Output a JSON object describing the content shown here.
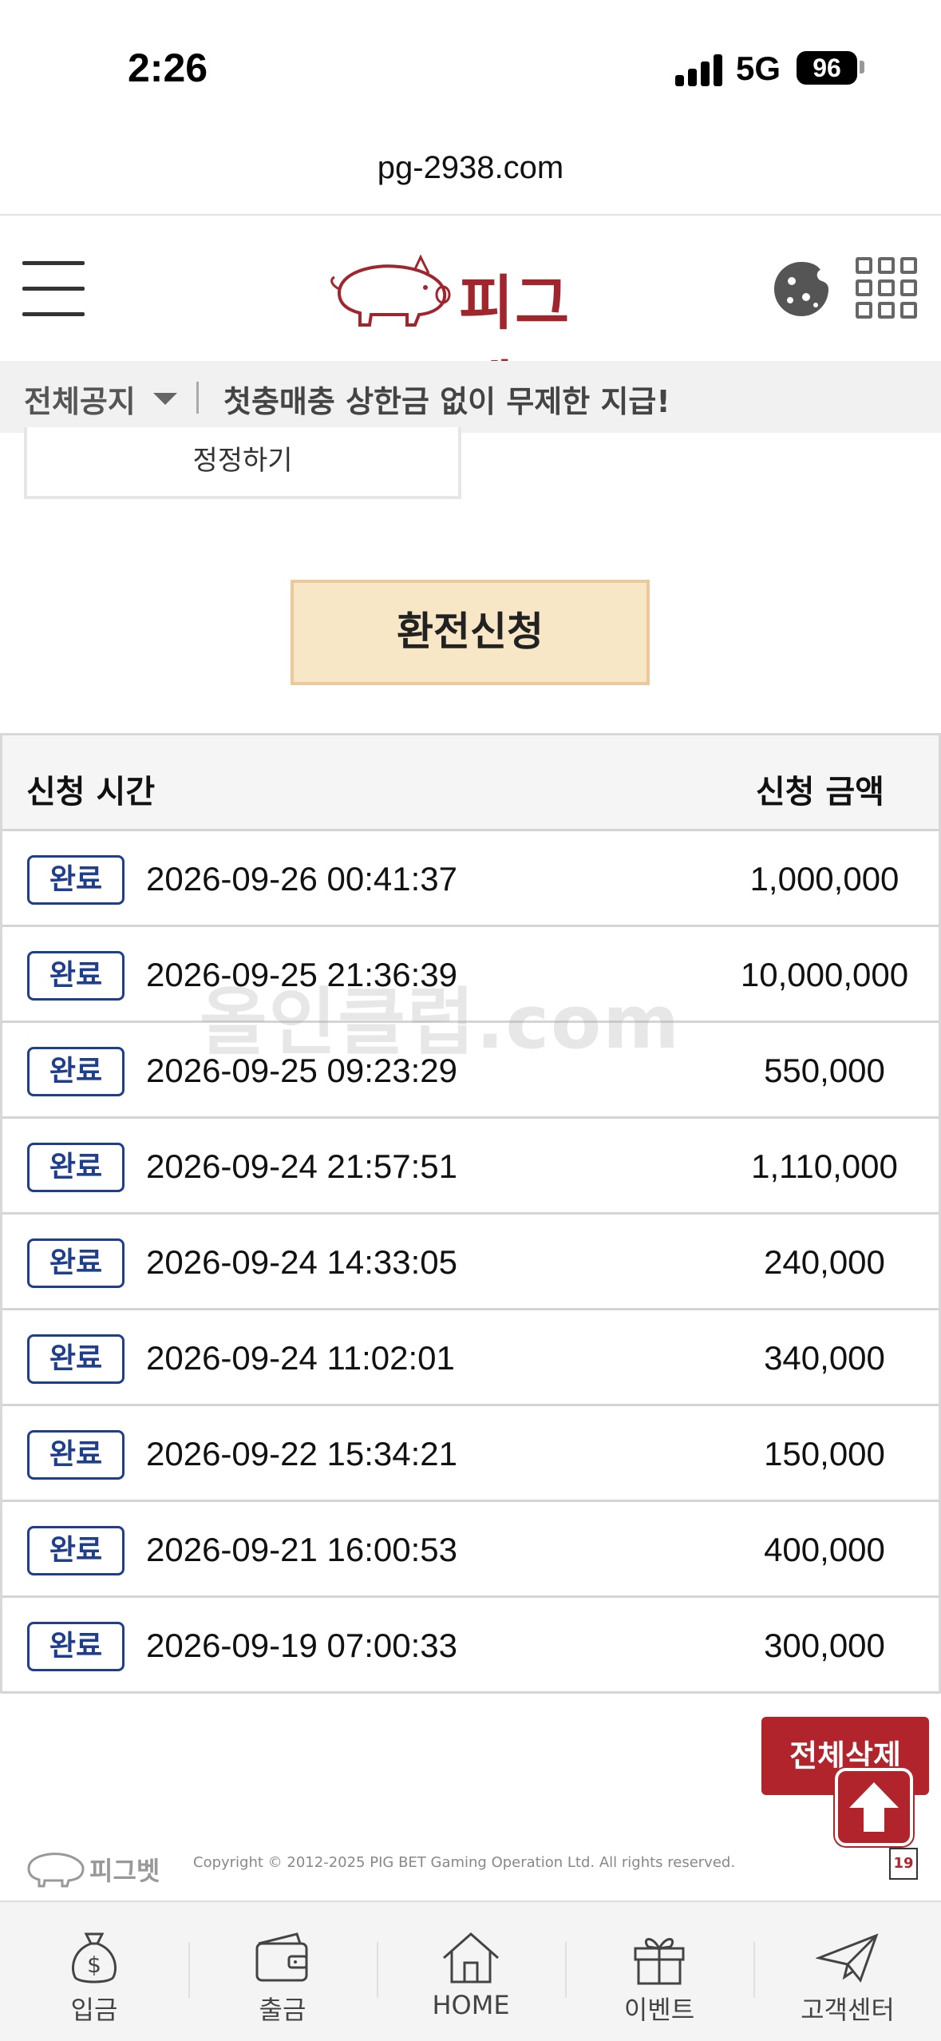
{
  "status": {
    "time": "2:26",
    "network": "5G",
    "battery": "96"
  },
  "browser": {
    "url": "pg-2938.com"
  },
  "header": {
    "logo_text": "피그벳"
  },
  "notice": {
    "label": "전체공지",
    "text": "첫충매충 상한금 없이 무제한 지급!"
  },
  "buttons": {
    "correct": "정정하기",
    "exchange": "환전신청",
    "delete_all": "전체삭제"
  },
  "table": {
    "col_time": "신청 시간",
    "col_amount": "신청 금액",
    "rows": [
      {
        "status": "완료",
        "time": "2026-09-26 00:41:37",
        "amount": "1,000,000"
      },
      {
        "status": "완료",
        "time": "2026-09-25 21:36:39",
        "amount": "10,000,000"
      },
      {
        "status": "완료",
        "time": "2026-09-25 09:23:29",
        "amount": "550,000"
      },
      {
        "status": "완료",
        "time": "2026-09-24 21:57:51",
        "amount": "1,110,000"
      },
      {
        "status": "완료",
        "time": "2026-09-24 14:33:05",
        "amount": "240,000"
      },
      {
        "status": "완료",
        "time": "2026-09-24 11:02:01",
        "amount": "340,000"
      },
      {
        "status": "완료",
        "time": "2026-09-22 15:34:21",
        "amount": "150,000"
      },
      {
        "status": "완료",
        "time": "2026-09-21 16:00:53",
        "amount": "400,000"
      },
      {
        "status": "완료",
        "time": "2026-09-19 07:00:33",
        "amount": "300,000"
      }
    ]
  },
  "watermark": "올인클럽.com",
  "footer": {
    "logo_text": "피그벳",
    "copyright": "Copyright © 2012-2025 PIG BET Gaming Operation Ltd. All rights reserved.",
    "age_badge": "19"
  },
  "nav": {
    "deposit": "입금",
    "withdraw": "출금",
    "home": "HOME",
    "event": "이벤트",
    "support": "고객센터"
  },
  "colors": {
    "brand_red": "#b1242c",
    "badge_blue": "#1f3f8e",
    "exchange_bg": "#f7e7c6"
  }
}
